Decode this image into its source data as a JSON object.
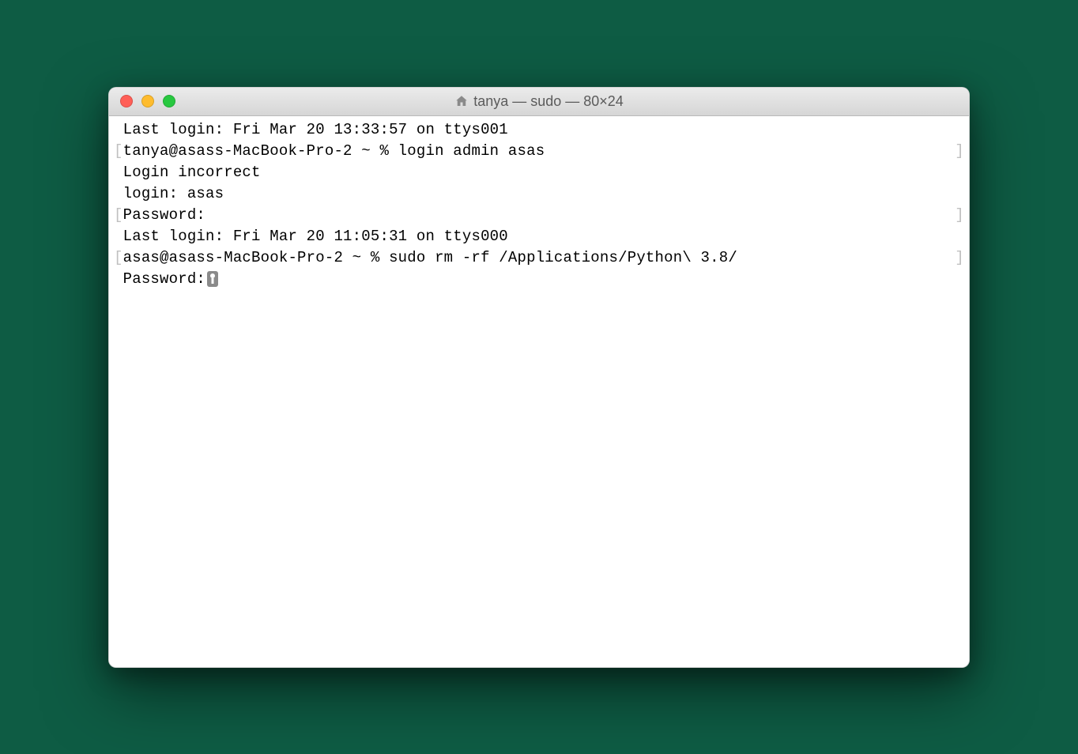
{
  "window": {
    "title": "tanya — sudo — 80×24"
  },
  "terminal": {
    "lines": [
      {
        "prefix": " ",
        "text": "Last login: Fri Mar 20 13:33:57 on ttys001",
        "suffix": ""
      },
      {
        "prefix": "[",
        "text": "tanya@asass-MacBook-Pro-2 ~ % login admin asas",
        "suffix": "]"
      },
      {
        "prefix": " ",
        "text": "Login incorrect",
        "suffix": ""
      },
      {
        "prefix": " ",
        "text": "login: asas",
        "suffix": ""
      },
      {
        "prefix": "[",
        "text": "Password:",
        "suffix": "]"
      },
      {
        "prefix": " ",
        "text": "Last login: Fri Mar 20 11:05:31 on ttys000",
        "suffix": ""
      },
      {
        "prefix": "[",
        "text": "asas@asass-MacBook-Pro-2 ~ % sudo rm -rf /Applications/Python\\ 3.8/",
        "suffix": "]"
      }
    ],
    "password_prompt": "Password:"
  }
}
